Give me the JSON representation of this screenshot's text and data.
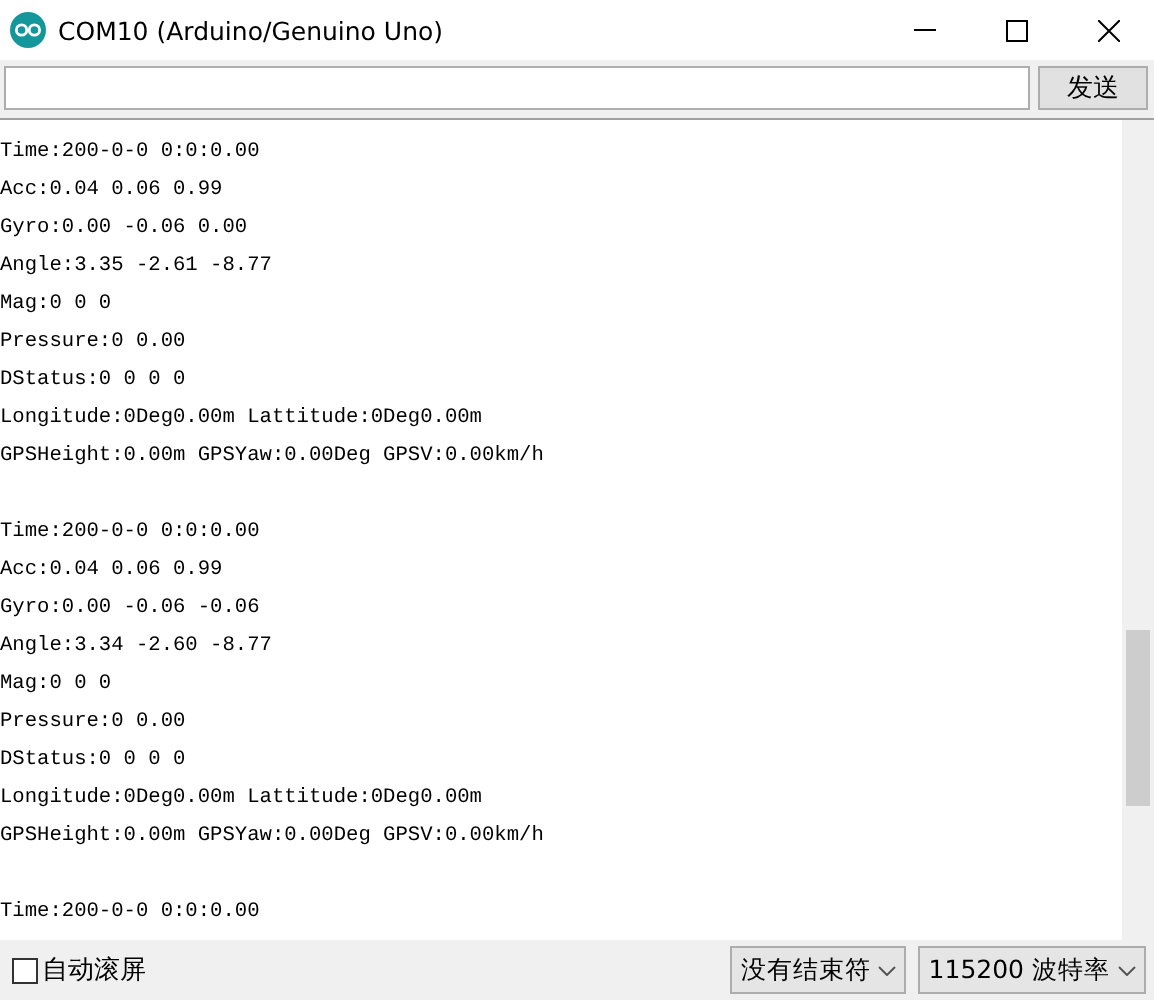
{
  "window": {
    "title": "COM10 (Arduino/Genuino Uno)"
  },
  "send_bar": {
    "button": "发送"
  },
  "records": [
    {
      "lines": [
        "Time:200-0-0 0:0:0.00",
        "Acc:0.04 0.06 0.99",
        "Gyro:0.00 -0.06 0.00",
        "Angle:3.35 -2.61 -8.77",
        "Mag:0 0 0",
        "Pressure:0 0.00",
        "DStatus:0 0 0 0",
        "Longitude:0Deg0.00m Lattitude:0Deg0.00m",
        "GPSHeight:0.00m GPSYaw:0.00Deg GPSV:0.00km/h"
      ]
    },
    {
      "lines": [
        "Time:200-0-0 0:0:0.00",
        "Acc:0.04 0.06 0.99",
        "Gyro:0.00 -0.06 -0.06",
        "Angle:3.34 -2.60 -8.77",
        "Mag:0 0 0",
        "Pressure:0 0.00",
        "DStatus:0 0 0 0",
        "Longitude:0Deg0.00m Lattitude:0Deg0.00m",
        "GPSHeight:0.00m GPSYaw:0.00Deg GPSV:0.00km/h"
      ]
    },
    {
      "lines": [
        "Time:200-0-0 0:0:0.00"
      ]
    }
  ],
  "status_bar": {
    "autoscroll": {
      "label": "自动滚屏",
      "checked": false
    },
    "line_ending": "没有结束符",
    "baud_rate": "115200 波特率"
  }
}
